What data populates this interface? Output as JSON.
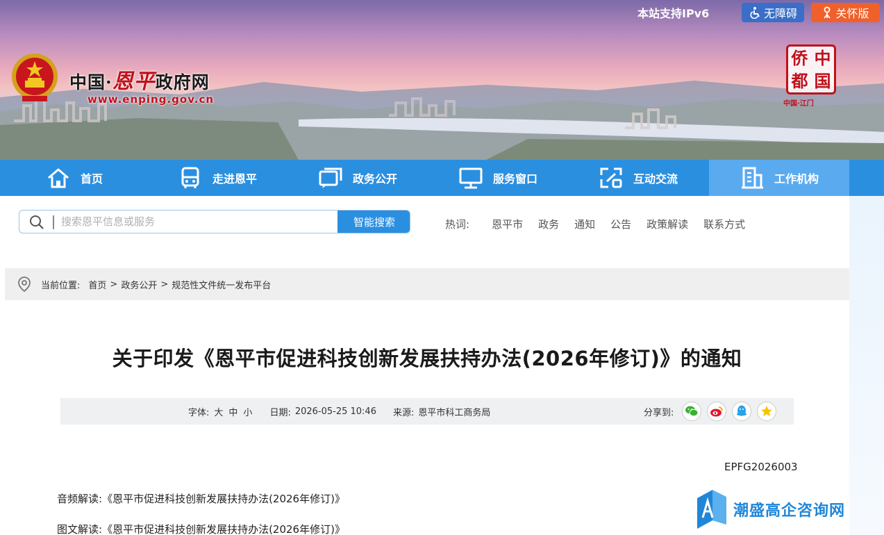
{
  "header": {
    "site_name_prefix": "中国·",
    "site_name_city": "恩平",
    "site_name_suffix": "政府网",
    "site_url": "www.enping.gov.cn",
    "ipv6_notice": "本站支持IPv6",
    "accessibility_label": "无障碍",
    "care_mode_label": "关怀版",
    "qiaodu_logo_chars": [
      "侨",
      "中",
      "都",
      "国"
    ],
    "qiaodu_logo_sub": "中国·江门"
  },
  "nav": {
    "items": [
      {
        "label": "首页",
        "icon": "home-icon"
      },
      {
        "label": "走进恩平",
        "icon": "bus-icon"
      },
      {
        "label": "政务公开",
        "icon": "chat-window-icon"
      },
      {
        "label": "服务窗口",
        "icon": "monitor-icon"
      },
      {
        "label": "互动交流",
        "icon": "interaction-icon"
      },
      {
        "label": "工作机构",
        "icon": "building-icon"
      }
    ],
    "active_index": 5
  },
  "search": {
    "placeholder": "搜索恩平信息或服务",
    "button_label": "智能搜索"
  },
  "hot_words": {
    "label": "热词:",
    "items": [
      "恩平市",
      "政务",
      "通知",
      "公告",
      "政策解读",
      "联系方式"
    ]
  },
  "breadcrumb": {
    "label": "当前位置:",
    "items": [
      "首页",
      "政务公开",
      "规范性文件统一发布平台"
    ]
  },
  "article": {
    "title": "关于印发《恩平市促进科技创新发展扶持办法(2026年修订)》的通知",
    "font_size_label": "字体:",
    "font_sizes": [
      "大",
      "中",
      "小"
    ],
    "date_label": "日期:",
    "date": "2026-05-25 10:46",
    "source_label": "来源:",
    "source": "恩平市科工商务局",
    "share_label": "分享到:",
    "share_targets": [
      "wechat-icon",
      "weibo-icon",
      "qq-icon",
      "qzone-icon"
    ],
    "doc_number": "EPFG2026003",
    "audio_interp_label": "音频解读:",
    "audio_interp_link": "《恩平市促进科技创新发展扶持办法(2026年修订)》",
    "graphic_interp_label": "图文解读:",
    "graphic_interp_link": "《恩平市促进科技创新发展扶持办法(2026年修订)》"
  },
  "watermark": {
    "text": "潮盛高企咨询网"
  },
  "colors": {
    "nav_blue": "#2b8fe0",
    "nav_active": "#5aaaf0",
    "brand_red": "#c0111b",
    "care_orange": "#f0602a",
    "access_blue": "#3a6ec8"
  }
}
